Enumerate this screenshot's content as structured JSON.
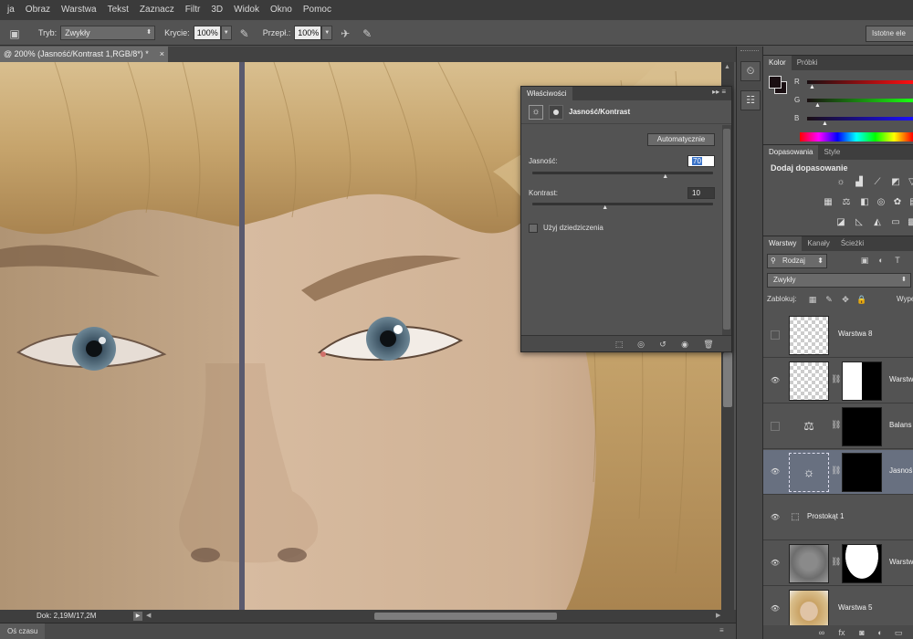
{
  "menu": [
    "ja",
    "Obraz",
    "Warstwa",
    "Tekst",
    "Zaznacz",
    "Filtr",
    "3D",
    "Widok",
    "Okno",
    "Pomoc"
  ],
  "options": {
    "mode_label": "Tryb:",
    "mode_value": "Zwykły",
    "opacity_label": "Krycie:",
    "opacity_value": "100%",
    "flow_label": "Przepł.:",
    "flow_value": "100%",
    "workspace": "Istotne ele"
  },
  "document": {
    "tab_title": "@ 200% (Jasność/Kontrast 1,RGB/8*) *",
    "close": "×"
  },
  "status": {
    "doc_size": "Dok: 2,19M/17,2M",
    "timeline_tab": "Oś czasu"
  },
  "properties": {
    "tab": "Właściwości",
    "title": "Jasność/Kontrast",
    "auto_button": "Automatycznie",
    "brightness_label": "Jasność:",
    "brightness_value": "70",
    "contrast_label": "Kontrast:",
    "contrast_value": "10",
    "legacy_label": "Użyj dziedziczenia"
  },
  "color_panel": {
    "tabs": [
      "Kolor",
      "Próbki"
    ],
    "channels": [
      "R",
      "G",
      "B"
    ],
    "fg_color": "#1a0f12"
  },
  "adjustments_panel": {
    "tabs": [
      "Dopasowania",
      "Style"
    ],
    "heading": "Dodaj dopasowanie"
  },
  "layers_panel": {
    "tabs": [
      "Warstwy",
      "Kanały",
      "Ścieżki"
    ],
    "filter": "Rodzaj",
    "blend": "Zwykły",
    "lock_label": "Zablokuj:",
    "fill_label": "Wype",
    "layers": [
      {
        "name": "Warstwa 8",
        "visible": false,
        "thumb": "checker",
        "mask": ""
      },
      {
        "name": "Warstw",
        "visible": true,
        "thumb": "checker",
        "mask": "half"
      },
      {
        "name": "Balans",
        "visible": false,
        "thumb": "balance-icon",
        "mask": "black"
      },
      {
        "name": "Jasnoś",
        "visible": true,
        "thumb": "sun-icon",
        "mask": "black",
        "selected": true
      },
      {
        "name": "Prostokąt 1",
        "visible": true,
        "thumb": "rect-icon",
        "mask": ""
      },
      {
        "name": "Warstw",
        "visible": true,
        "thumb": "face-gray",
        "mask": "white-shape"
      },
      {
        "name": "Warstwa 5",
        "visible": true,
        "thumb": "face-photo",
        "mask": ""
      }
    ]
  }
}
